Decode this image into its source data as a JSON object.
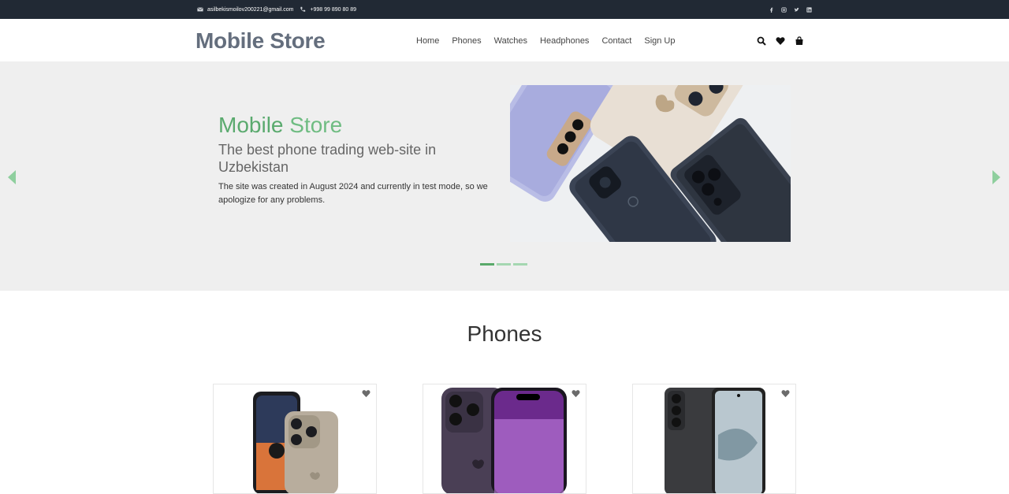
{
  "topbar": {
    "email": "asilbekismoilov200221@gmail.com",
    "phone": "+998 99 890 80 89",
    "social": [
      "facebook-icon",
      "instagram-icon",
      "twitter-icon",
      "linkedin-icon"
    ]
  },
  "nav": {
    "brand": "Mobile Store",
    "menu": [
      "Home",
      "Phones",
      "Watches",
      "Headphones",
      "Contact",
      "Sign Up"
    ],
    "icons": [
      "search-icon",
      "heart-icon",
      "shopping-bag-icon"
    ]
  },
  "hero": {
    "title_part1": "Mobile",
    "title_part2": "Store",
    "subtitle": "The best phone trading web-site in Uzbekistan",
    "description": "The site was created in August 2024 and currently in test mode, so we apologize for any problems.",
    "slides": 3,
    "active_slide": 0
  },
  "phones": {
    "title": "Phones"
  },
  "colors": {
    "topbar": "#212934",
    "accent": "#59a96a",
    "brand": "#646e7d"
  }
}
